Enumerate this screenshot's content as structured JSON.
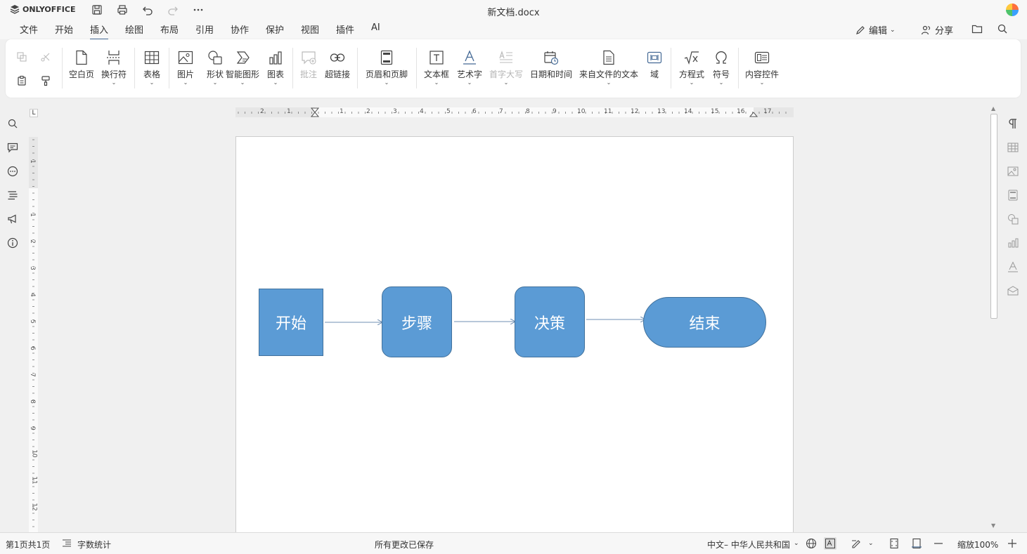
{
  "app": {
    "brand": "ONLYOFFICE",
    "document_title": "新文档.docx"
  },
  "menu": {
    "items": [
      "文件",
      "开始",
      "插入",
      "绘图",
      "布局",
      "引用",
      "协作",
      "保护",
      "视图",
      "插件",
      "AI"
    ],
    "active": "插入",
    "edit_label": "编辑",
    "share_label": "分享"
  },
  "toolbar": {
    "blank_page": "空白页",
    "break": "换行符",
    "table": "表格",
    "image": "图片",
    "shape": "形状",
    "smartart": "智能图形",
    "chart": "图表",
    "comment": "批注",
    "hyperlink": "超链接",
    "header_footer": "页眉和页脚",
    "text_box": "文本框",
    "text_art": "艺术字",
    "drop_cap": "首字大写",
    "date_time": "日期和时间",
    "text_from_file": "来自文件的文本",
    "field": "域",
    "equation": "方程式",
    "symbol": "符号",
    "content_controls": "内容控件"
  },
  "ruler": {
    "h_numbers": [
      "2",
      "1",
      "1",
      "2",
      "3",
      "4",
      "5",
      "6",
      "7",
      "8",
      "9",
      "10",
      "11",
      "12",
      "13",
      "14",
      "15",
      "16",
      "17"
    ],
    "v_numbers": [
      "1",
      "1",
      "2",
      "3",
      "4",
      "5",
      "6",
      "7",
      "8",
      "9",
      "10",
      "11",
      "12"
    ]
  },
  "flowchart": {
    "nodes": [
      "开始",
      "步骤",
      "决策",
      "结束"
    ],
    "fill_color": "#5b9bd5",
    "border_color": "#41719c",
    "arrow_color": "#6f8fb3"
  },
  "status": {
    "page_info": "第1页共1页",
    "word_count": "字数统计",
    "save_state": "所有更改已保存",
    "language": "中文– 中华人民共和国",
    "zoom": "缩放100%"
  }
}
